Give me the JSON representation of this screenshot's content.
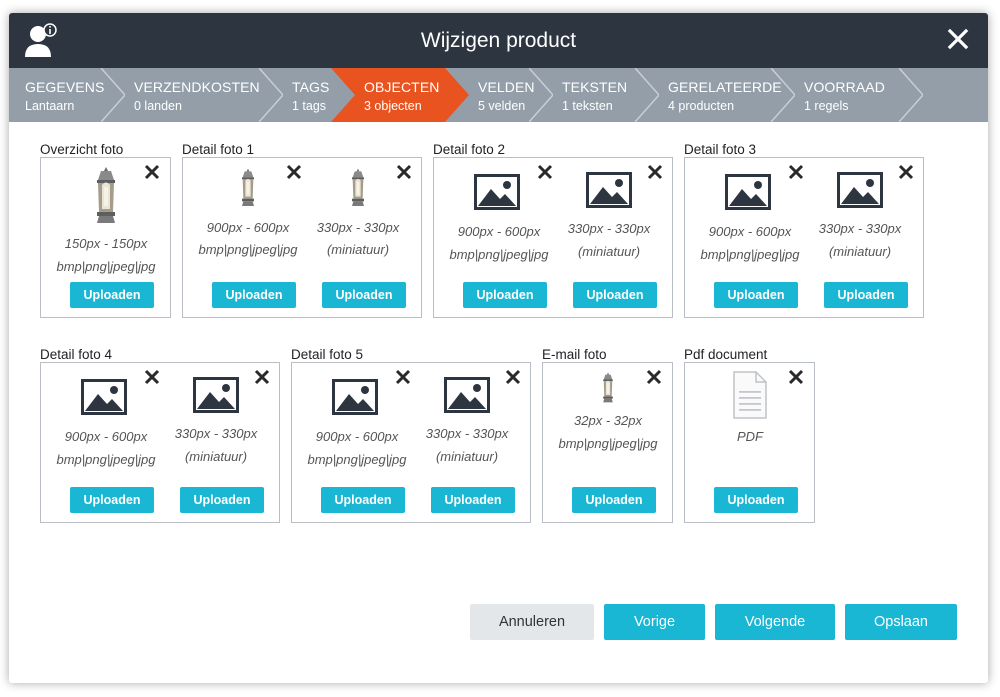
{
  "header": {
    "title": "Wijzigen product",
    "user_icon": "user-info-icon",
    "close_icon": "close-icon"
  },
  "steps": [
    {
      "label": "GEGEVENS",
      "sub": "Lantaarn",
      "active": false
    },
    {
      "label": "VERZENDKOSTEN",
      "sub": "0 landen",
      "active": false
    },
    {
      "label": "TAGS",
      "sub": "1 tags",
      "active": false
    },
    {
      "label": "OBJECTEN",
      "sub": "3 objecten",
      "active": true
    },
    {
      "label": "VELDEN",
      "sub": "5 velden",
      "active": false
    },
    {
      "label": "TEKSTEN",
      "sub": "1 teksten",
      "active": false
    },
    {
      "label": "GERELATEERDE",
      "sub": "4 producten",
      "active": false
    },
    {
      "label": "VOORRAAD",
      "sub": "1 regels",
      "active": false
    }
  ],
  "colors": {
    "header_bg": "#2d3540",
    "steps_bg": "#949ea8",
    "active_step": "#e8531f",
    "accent": "#1ab7d4"
  },
  "upload_label": "Uploaden",
  "sections": [
    {
      "title": "Overzicht foto",
      "slots": [
        {
          "dim": "150px - 150px",
          "fmt": "bmp|png|jpeg|jpg",
          "image": "lantern"
        }
      ]
    },
    {
      "title": "Detail foto 1",
      "slots": [
        {
          "dim": "900px - 600px",
          "fmt": "bmp|png|jpeg|jpg",
          "image": "lantern"
        },
        {
          "dim": "330px - 330px",
          "fmt": "(miniatuur)",
          "image": "lantern"
        }
      ]
    },
    {
      "title": "Detail foto 2",
      "slots": [
        {
          "dim": "900px - 600px",
          "fmt": "bmp|png|jpeg|jpg",
          "image": "placeholder"
        },
        {
          "dim": "330px - 330px",
          "fmt": "(miniatuur)",
          "image": "placeholder"
        }
      ]
    },
    {
      "title": "Detail foto 3",
      "slots": [
        {
          "dim": "900px - 600px",
          "fmt": "bmp|png|jpeg|jpg",
          "image": "placeholder"
        },
        {
          "dim": "330px - 330px",
          "fmt": "(miniatuur)",
          "image": "placeholder"
        }
      ]
    },
    {
      "title": "Detail foto 4",
      "slots": [
        {
          "dim": "900px - 600px",
          "fmt": "bmp|png|jpeg|jpg",
          "image": "placeholder"
        },
        {
          "dim": "330px - 330px",
          "fmt": "(miniatuur)",
          "image": "placeholder"
        }
      ]
    },
    {
      "title": "Detail foto 5",
      "slots": [
        {
          "dim": "900px - 600px",
          "fmt": "bmp|png|jpeg|jpg",
          "image": "placeholder"
        },
        {
          "dim": "330px - 330px",
          "fmt": "(miniatuur)",
          "image": "placeholder"
        }
      ]
    },
    {
      "title": "E-mail foto",
      "slots": [
        {
          "dim": "32px - 32px",
          "fmt": "bmp|png|jpeg|jpg",
          "image": "lantern"
        }
      ]
    },
    {
      "title": "Pdf document",
      "slots": [
        {
          "dim": "PDF",
          "fmt": "",
          "image": "document"
        }
      ]
    }
  ],
  "footer": {
    "cancel": "Annuleren",
    "prev": "Vorige",
    "next": "Volgende",
    "save": "Opslaan"
  }
}
